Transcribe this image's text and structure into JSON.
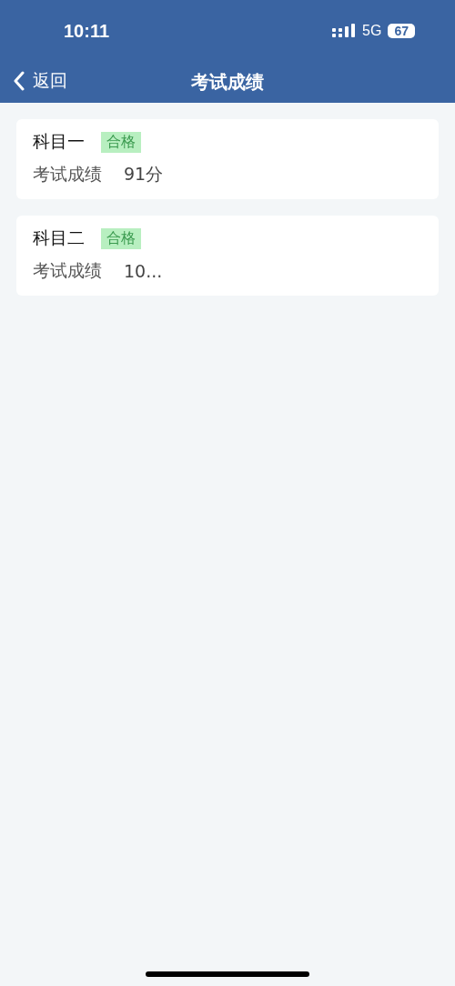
{
  "status_bar": {
    "time": "10:11",
    "network": "5G",
    "battery": "67"
  },
  "nav_bar": {
    "back": "返回",
    "title": "考试成绩"
  },
  "results": [
    {
      "subject": "科目一",
      "status": "合格",
      "label": "考试成绩",
      "score": "91分"
    },
    {
      "subject": "科目二",
      "status": "合格",
      "label": "考试成绩",
      "score": "10..."
    }
  ]
}
